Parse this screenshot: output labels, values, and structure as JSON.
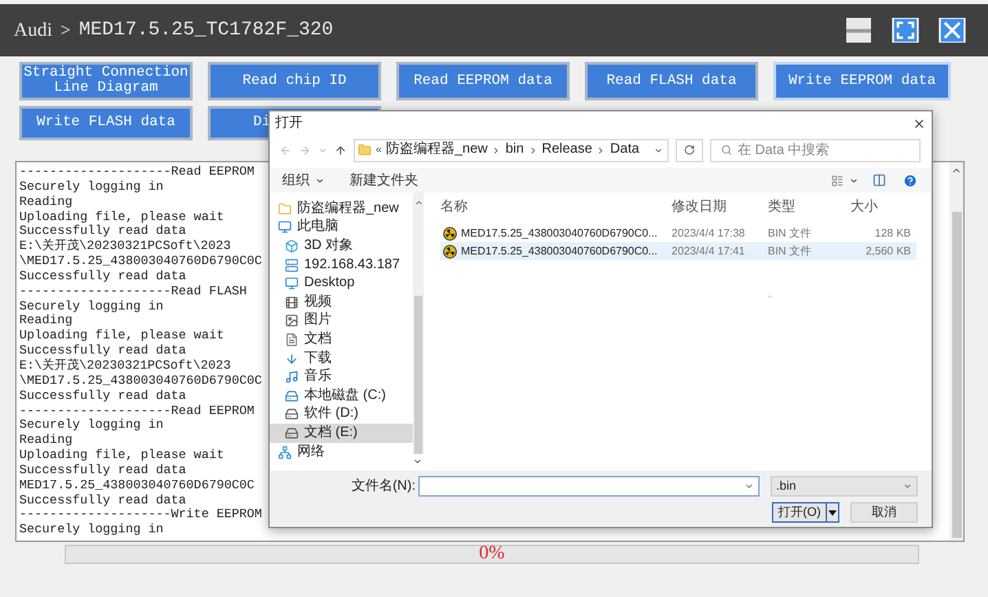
{
  "title": {
    "root": "Audi",
    "separator": ">",
    "model": "MED17.5.25_TC1782F_320"
  },
  "buttons": [
    {
      "label": "Straight Connection Line Diagram",
      "kind": "full",
      "focused": false
    },
    {
      "label": "Read chip ID",
      "kind": "full",
      "focused": false
    },
    {
      "label": "Read EEPROM data",
      "kind": "full",
      "focused": false
    },
    {
      "label": "Read FLASH data",
      "kind": "full",
      "focused": false
    },
    {
      "label": "Write EEPROM data",
      "kind": "full",
      "focused": true
    },
    {
      "label": "Write FLASH data",
      "kind": "full",
      "focused": false
    },
    {
      "label": "Di",
      "kind": "covered",
      "focused": false
    }
  ],
  "log": {
    "lines": [
      "--------------------Read EEPROM",
      "Securely logging in",
      "Reading",
      "Uploading file, please wait",
      "Successfully read data",
      "E:\\关开茂\\20230321PCSoft\\2023",
      "\\MED17.5.25_438003040760D6790C0C",
      "Successfully read data",
      "--------------------Read FLASH",
      "Securely logging in",
      "Reading",
      "Uploading file, please wait",
      "Successfully read data",
      "E:\\关开茂\\20230321PCSoft\\2023",
      "\\MED17.5.25_438003040760D6790C0C",
      "Successfully read data",
      "--------------------Read EEPROM",
      "Securely logging in",
      "Reading",
      "Uploading file, please wait",
      "Successfully read data",
      "MED17.5.25_438003040760D6790C0C",
      "Successfully read data",
      "--------------------Write EEPROM",
      "Securely logging in"
    ]
  },
  "progress": {
    "level": 0,
    "text": "0%"
  },
  "dialog": {
    "title": "打开",
    "overflow": "«",
    "path": [
      "防盗编程器_new",
      "bin",
      "Release",
      "Data"
    ],
    "search": {
      "placeholder": "在 Data 中搜索"
    },
    "toolbar": {
      "organize": "组织",
      "new_folder": "新建文件夹"
    },
    "sidebar": [
      {
        "label": "防盗编程器_new",
        "kind": "folder",
        "selected": false
      },
      {
        "label": "此电脑",
        "kind": "pc",
        "selected": false,
        "children": [
          {
            "label": "3D 对象",
            "kind": "cube",
            "selected": false
          },
          {
            "label": "192.168.43.187",
            "kind": "share",
            "selected": false
          },
          {
            "label": "Desktop",
            "kind": "desktop",
            "selected": false
          },
          {
            "label": "视频",
            "kind": "video",
            "selected": false
          },
          {
            "label": "图片",
            "kind": "image",
            "selected": false
          },
          {
            "label": "文档",
            "kind": "doc",
            "selected": false
          },
          {
            "label": "下载",
            "kind": "download",
            "selected": false
          },
          {
            "label": "音乐",
            "kind": "music",
            "selected": false
          },
          {
            "label": "本地磁盘 (C:)",
            "kind": "system_drive",
            "selected": false
          },
          {
            "label": "软件 (D:)",
            "kind": "drive",
            "selected": false
          },
          {
            "label": "文档 (E:)",
            "kind": "drive",
            "selected": true
          }
        ]
      },
      {
        "label": "网络",
        "kind": "network",
        "selected": false
      }
    ],
    "columns": [
      "名称",
      "修改日期",
      "类型",
      "大小"
    ],
    "files": [
      {
        "name": "MED17.5.25_438003040760D6790C0...",
        "modified": "2023/4/4 17:38",
        "type": "BIN 文件",
        "size": "128 KB",
        "selected": false
      },
      {
        "name": "MED17.5.25_438003040760D6790C0...",
        "modified": "2023/4/4 17:41",
        "type": "BIN 文件",
        "size": "2,560 KB",
        "selected": true
      }
    ],
    "filename_label": "文件名(N):",
    "filter": ".bin",
    "open": "打开(O)",
    "cancel": "取消"
  }
}
